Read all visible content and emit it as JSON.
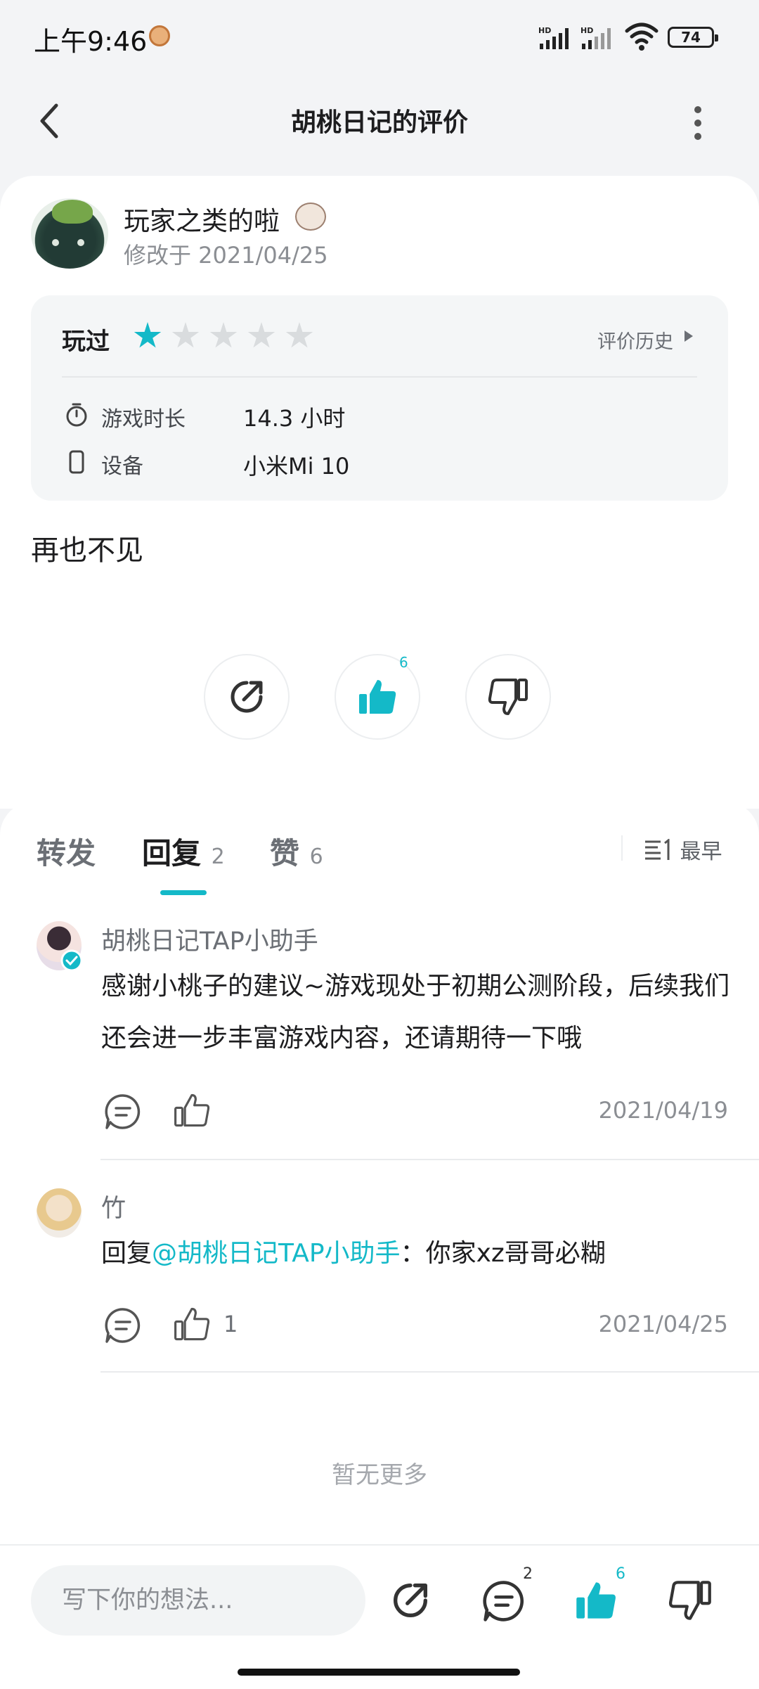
{
  "status_bar": {
    "time": "上午9:46",
    "battery": "74"
  },
  "header": {
    "title": "胡桃日记的评价"
  },
  "review": {
    "username": "玩家之类的啦",
    "modified": "修改于 2021/04/25",
    "played_label": "玩过",
    "rating": 1,
    "rating_max": 5,
    "history_label": "评价历史",
    "playtime_label": "游戏时长",
    "playtime_value": "14.3 小时",
    "device_label": "设备",
    "device_value": "小米Mi 10",
    "content": "再也不见",
    "like_count": "6"
  },
  "tabs": [
    {
      "label": "转发",
      "count": ""
    },
    {
      "label": "回复",
      "count": "2"
    },
    {
      "label": "赞",
      "count": "6"
    }
  ],
  "sort_label": "最早",
  "comments": [
    {
      "name": "胡桃日记TAP小助手",
      "text": "感谢小桃子的建议~游戏现处于初期公测阶段，后续我们还会进一步丰富游戏内容，还请期待一下哦",
      "likes": "",
      "date": "2021/04/19"
    },
    {
      "name": "竹",
      "reply_prefix": "回复",
      "mention": "@胡桃日记TAP小助手",
      "text": "：你家xz哥哥必糊",
      "likes": "1",
      "date": "2021/04/25"
    }
  ],
  "no_more": "暂无更多",
  "bottom_bar": {
    "input_placeholder": "写下你的想法...",
    "comment_count": "2",
    "like_count": "6"
  },
  "colors": {
    "accent": "#14b9c8",
    "text": "#1d1d1f",
    "muted": "#8b8e93"
  }
}
